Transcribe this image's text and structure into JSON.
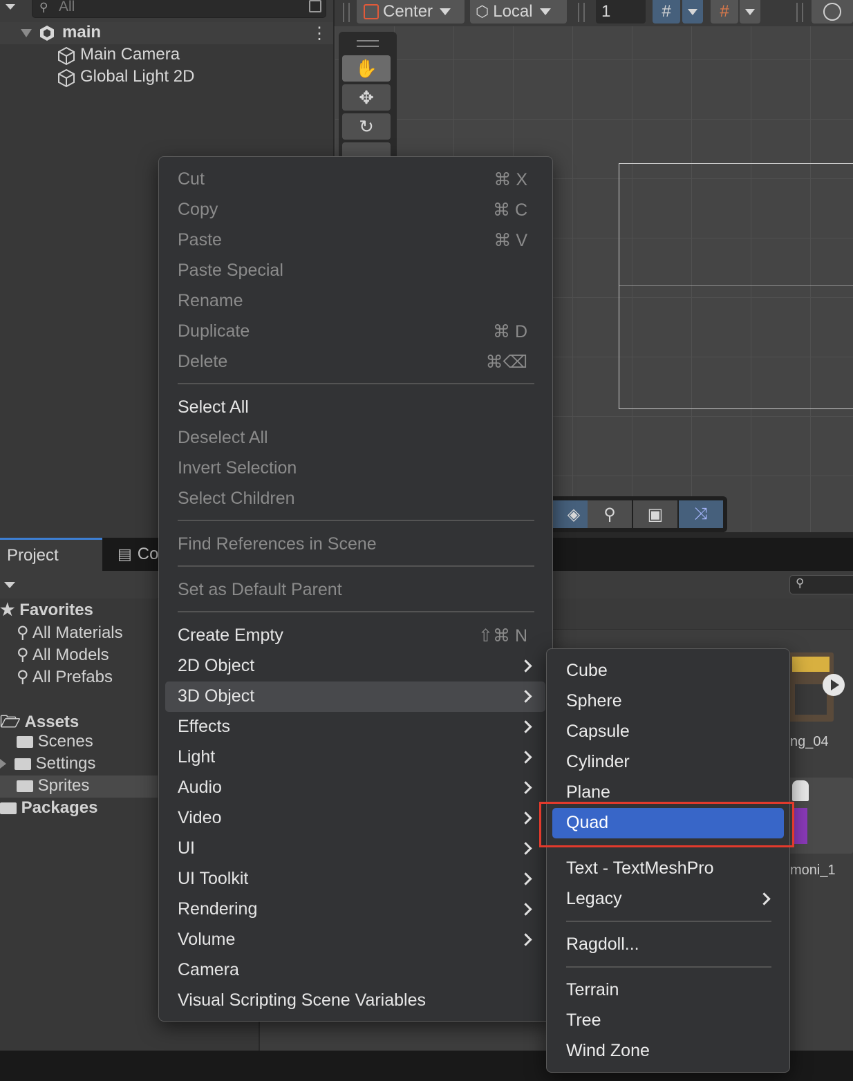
{
  "hierarchy": {
    "search_placeholder": "All",
    "scene_name": "main",
    "objects": [
      "Main Camera",
      "Global Light 2D"
    ]
  },
  "scene_toolbar": {
    "pivot_label": "Center",
    "space_label": "Local",
    "grid_value": "1"
  },
  "project": {
    "tab_project": "Project",
    "tab_console": "Co",
    "favorites_label": "Favorites",
    "favorites": [
      "All Materials",
      "All Models",
      "All Prefabs"
    ],
    "assets_label": "Assets",
    "assets": [
      "Scenes",
      "Settings",
      "Sprites"
    ],
    "packages_label": "Packages",
    "thumb1_label": "ng_04",
    "thumb2_label": "moni_1"
  },
  "context_menu": {
    "items": [
      {
        "label": "Cut",
        "shortcut": "⌘ X"
      },
      {
        "label": "Copy",
        "shortcut": "⌘ C"
      },
      {
        "label": "Paste",
        "shortcut": "⌘ V"
      },
      {
        "label": "Paste Special",
        "shortcut": ""
      },
      {
        "label": "Rename",
        "shortcut": ""
      },
      {
        "label": "Duplicate",
        "shortcut": "⌘ D"
      },
      {
        "label": "Delete",
        "shortcut": "⌘⌫"
      },
      {
        "label": "Select All",
        "shortcut": ""
      },
      {
        "label": "Deselect All",
        "shortcut": ""
      },
      {
        "label": "Invert Selection",
        "shortcut": ""
      },
      {
        "label": "Select Children",
        "shortcut": ""
      },
      {
        "label": "Find References in Scene",
        "shortcut": ""
      },
      {
        "label": "Set as Default Parent",
        "shortcut": ""
      },
      {
        "label": "Create Empty",
        "shortcut": "⇧⌘ N"
      },
      {
        "label": "2D Object"
      },
      {
        "label": "3D Object"
      },
      {
        "label": "Effects"
      },
      {
        "label": "Light"
      },
      {
        "label": "Audio"
      },
      {
        "label": "Video"
      },
      {
        "label": "UI"
      },
      {
        "label": "UI Toolkit"
      },
      {
        "label": "Rendering"
      },
      {
        "label": "Volume"
      },
      {
        "label": "Camera"
      },
      {
        "label": "Visual Scripting Scene Variables"
      }
    ]
  },
  "submenu_3d": {
    "items": [
      {
        "label": "Cube"
      },
      {
        "label": "Sphere"
      },
      {
        "label": "Capsule"
      },
      {
        "label": "Cylinder"
      },
      {
        "label": "Plane"
      },
      {
        "label": "Quad"
      },
      {
        "label": "Text - TextMeshPro"
      },
      {
        "label": "Legacy"
      },
      {
        "label": "Ragdoll..."
      },
      {
        "label": "Terrain"
      },
      {
        "label": "Tree"
      },
      {
        "label": "Wind Zone"
      }
    ],
    "selected": "Quad"
  },
  "colors": {
    "selection_blue": "#3866c8",
    "highlight_red": "#e33a2c",
    "menu_bg": "#323335"
  }
}
